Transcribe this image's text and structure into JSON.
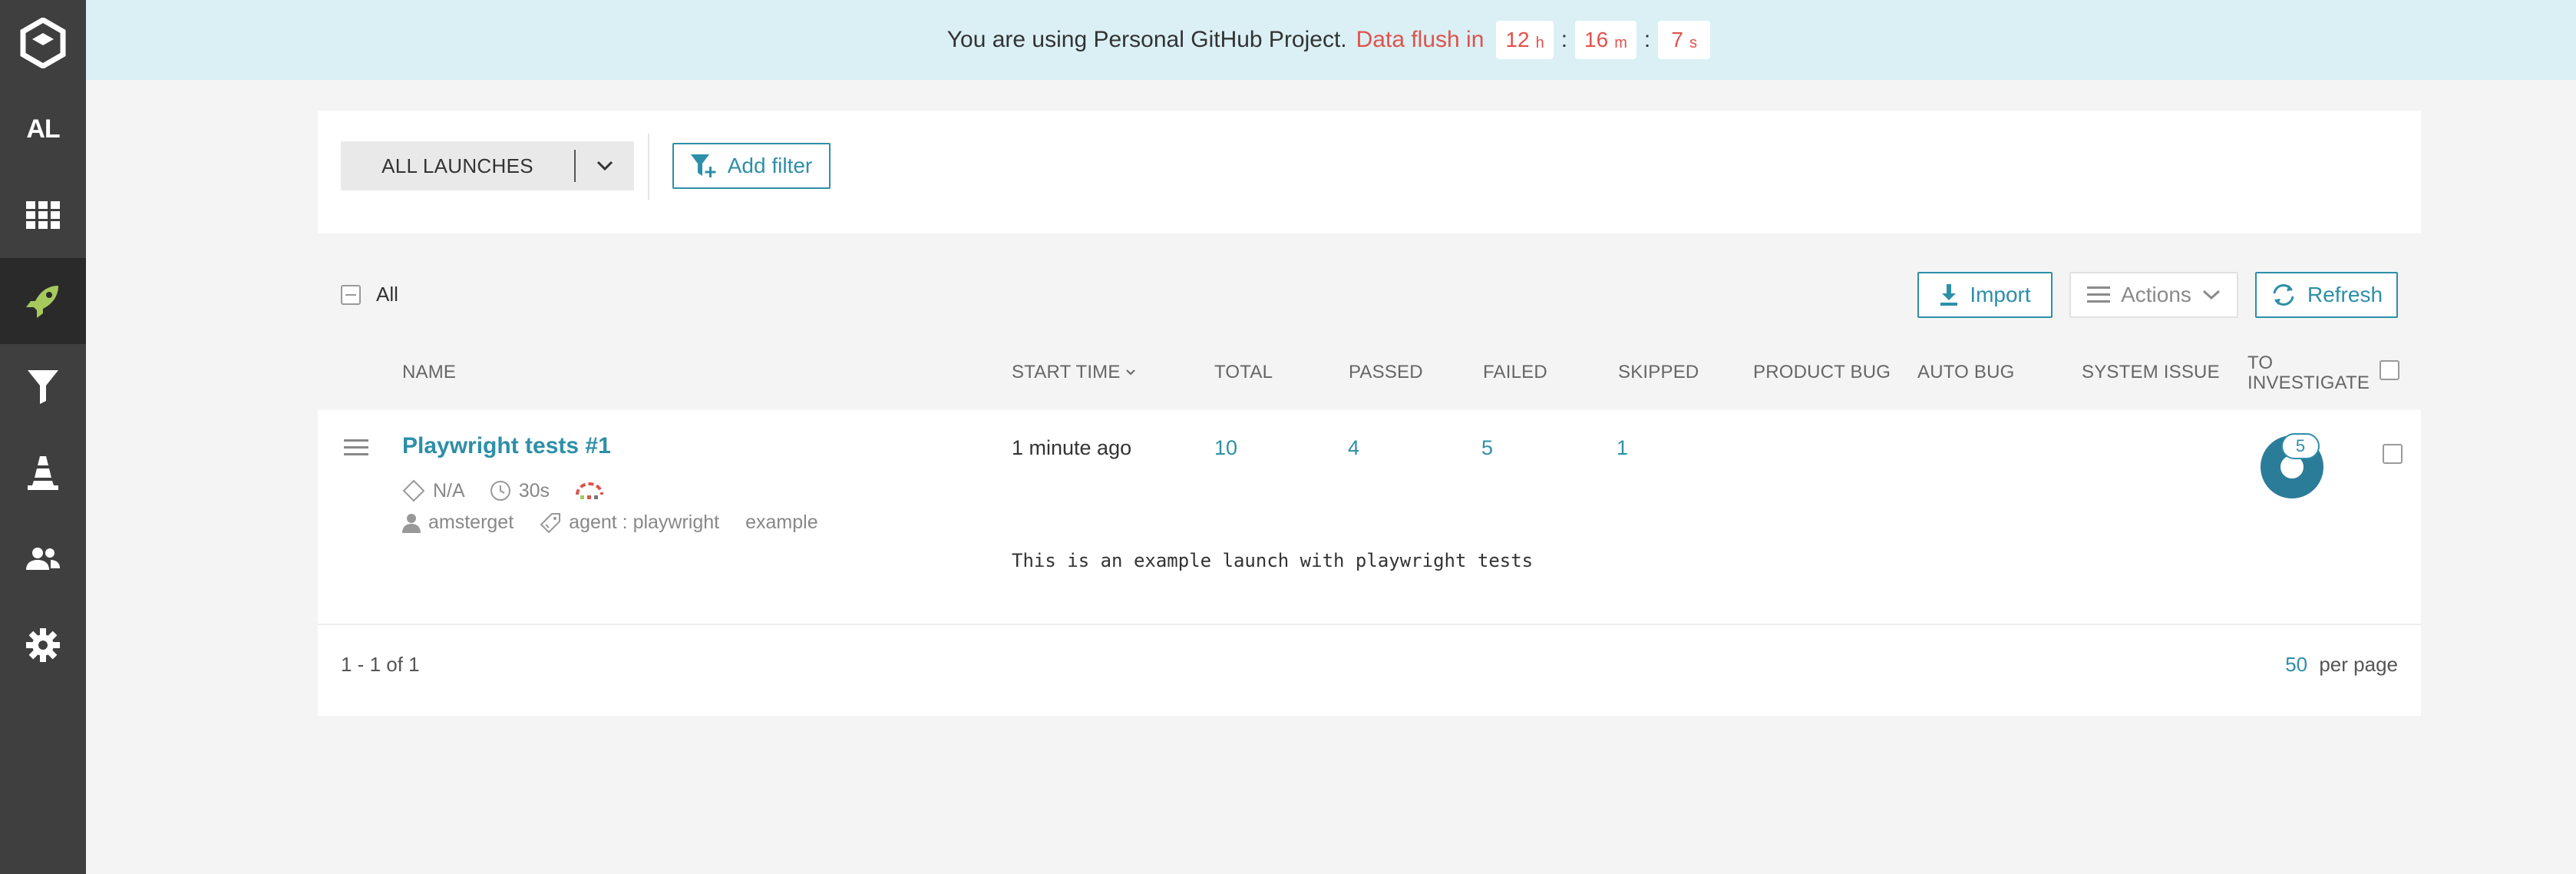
{
  "sidebar": {
    "project_abbr": "AL",
    "items": [
      {
        "name": "logo",
        "icon": "report-portal-logo-icon"
      },
      {
        "name": "project",
        "icon": "project-abbr"
      },
      {
        "name": "dashboards",
        "icon": "dashboard-grid-icon"
      },
      {
        "name": "launches",
        "icon": "rocket-icon",
        "active": true
      },
      {
        "name": "filters",
        "icon": "filter-icon"
      },
      {
        "name": "debug",
        "icon": "cone-icon"
      },
      {
        "name": "members",
        "icon": "members-icon"
      },
      {
        "name": "settings",
        "icon": "gear-icon"
      }
    ]
  },
  "banner": {
    "message": "You are using Personal GitHub Project.",
    "flush_label": "Data flush in",
    "hours": "12",
    "hours_unit": "h",
    "minutes": "16",
    "minutes_unit": "m",
    "seconds": "7",
    "seconds_unit": "s",
    "separator": ":"
  },
  "filter": {
    "selected": "ALL LAUNCHES",
    "add_filter_label": "Add filter"
  },
  "toolbar": {
    "select_all_label": "All",
    "import_label": "Import",
    "actions_label": "Actions",
    "refresh_label": "Refresh"
  },
  "table": {
    "headers": {
      "name": "NAME",
      "start_time": "START TIME",
      "total": "TOTAL",
      "passed": "PASSED",
      "failed": "FAILED",
      "skipped": "SKIPPED",
      "product_bug": "PRODUCT BUG",
      "auto_bug": "AUTO BUG",
      "system_issue": "SYSTEM ISSUE",
      "to_investigate_1": "TO",
      "to_investigate_2": "INVESTIGATE"
    },
    "rows": [
      {
        "name": "Playwright tests #1",
        "version": "N/A",
        "duration": "30s",
        "owner": "amsterget",
        "attribute_1": "agent : playwright",
        "attribute_2": "example",
        "start_time": "1 minute ago",
        "total": "10",
        "passed": "4",
        "failed": "5",
        "skipped": "1",
        "to_investigate": "5",
        "description": "This is an example launch with playwright tests"
      }
    ]
  },
  "pagination": {
    "range": "1 - 1 of 1",
    "per_page_value": "50",
    "per_page_label": "per page"
  },
  "colors": {
    "accent": "#2d8fa8",
    "warning": "#e0524b",
    "banner_bg": "#daf0f5",
    "sidebar_bg": "#3f3f3f",
    "active_icon": "#a6c95e"
  }
}
